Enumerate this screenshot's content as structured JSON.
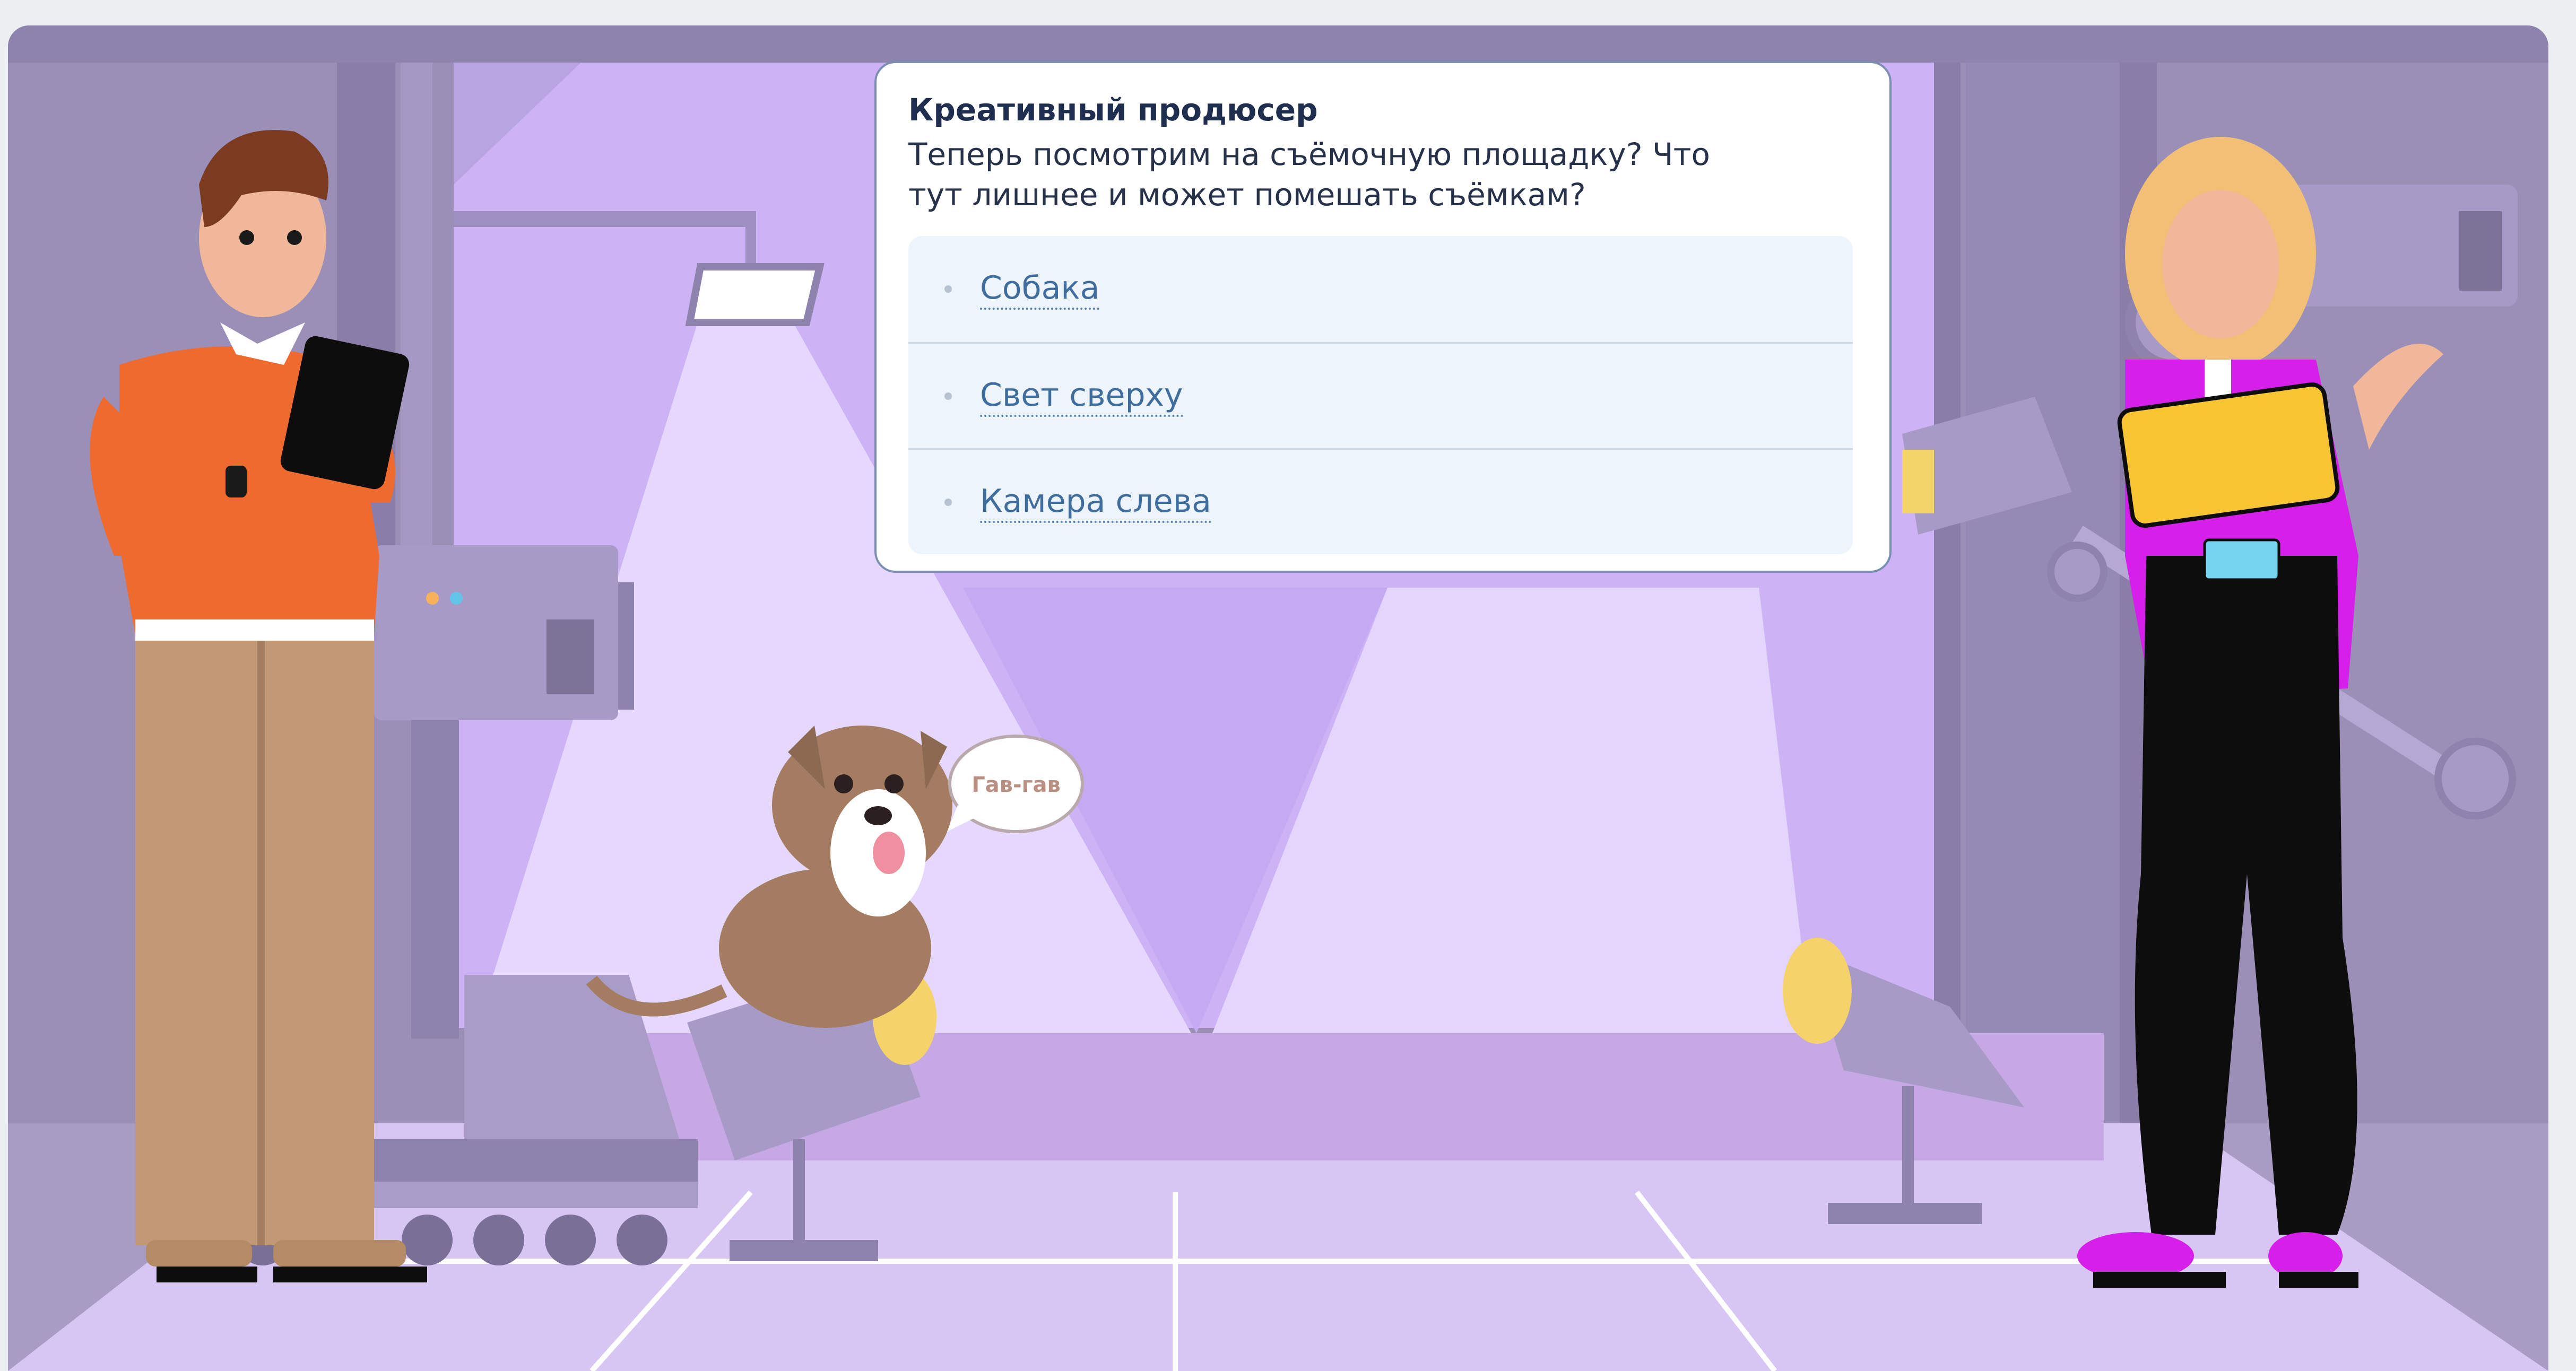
{
  "dialog": {
    "speaker": "Креативный продюсер",
    "question": "Теперь посмотрим на съёмочную площадку? Что тут лишнее и может помешать съёмкам?",
    "options": [
      {
        "label": "Собака"
      },
      {
        "label": "Свет сверху"
      },
      {
        "label": "Камера слева"
      }
    ]
  },
  "scene": {
    "dog_speech": "Гав-гав"
  },
  "colors": {
    "wall": "#9b8fb8",
    "backdrop": "#cdb3f6",
    "floor": "#d7c6f4",
    "dialog_border": "#7b8db0",
    "option_text": "#3f6e9e",
    "producer_sweater": "#ef6a2e",
    "assistant_jacket": "#d61fe8",
    "tablet_yellow": "#f7c531"
  }
}
